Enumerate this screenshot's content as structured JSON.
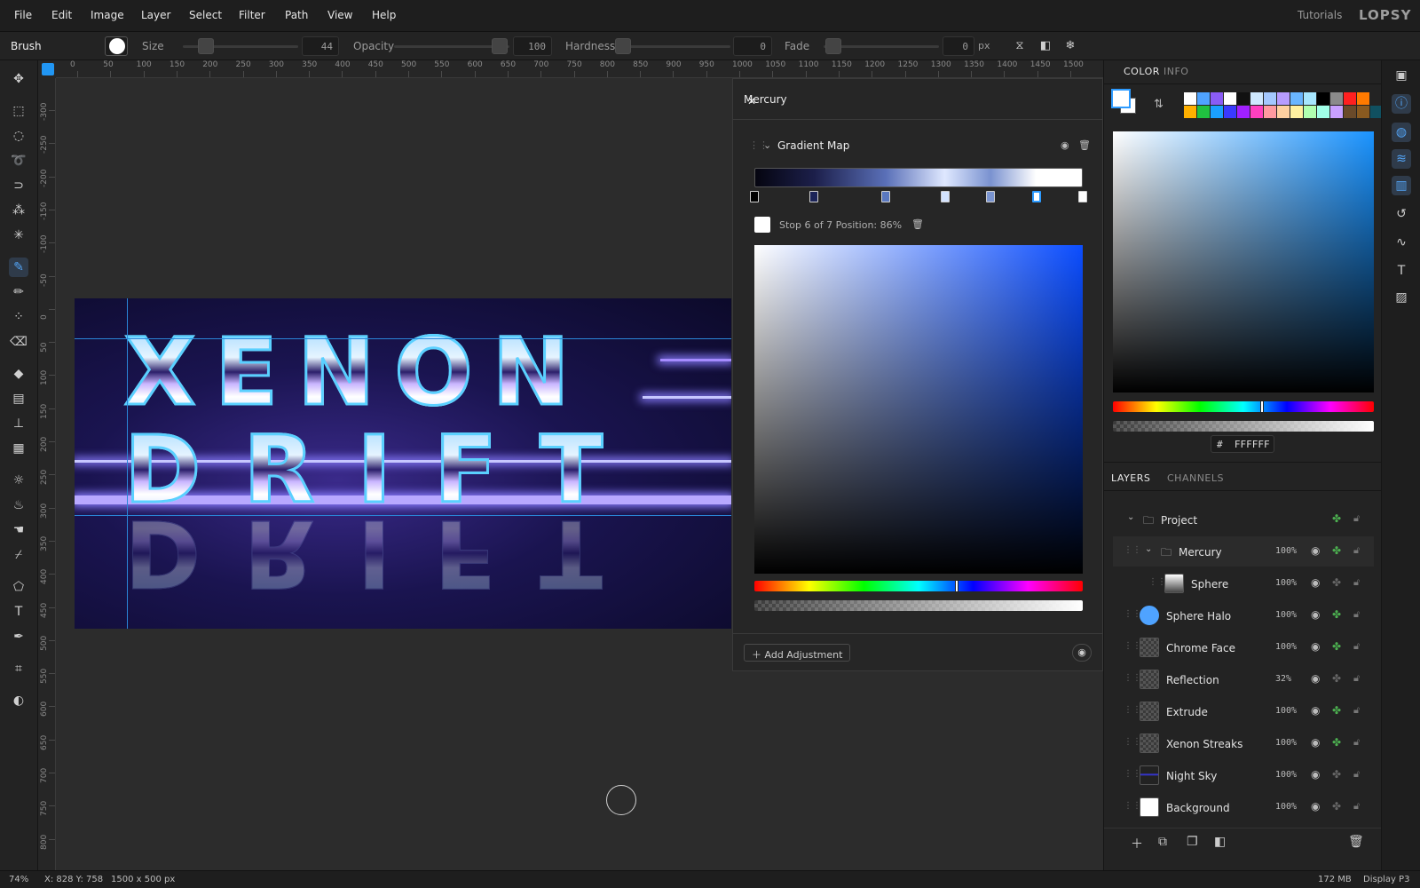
{
  "menu": [
    "File",
    "Edit",
    "Image",
    "Layer",
    "Select",
    "Filter",
    "Path",
    "View",
    "Help"
  ],
  "header": {
    "tutorials": "Tutorials",
    "logo": "LOPSY"
  },
  "options": {
    "tool": "Brush",
    "size_label": "Size",
    "size_value": "44",
    "opacity_label": "Opacity",
    "opacity_value": "100",
    "hardness_label": "Hardness",
    "hardness_value": "0",
    "fade_label": "Fade",
    "fade_value": "0",
    "fade_unit": "px"
  },
  "tools": [
    "move-icon",
    "rect-select-icon",
    "ellipse-select-icon",
    "lasso-icon",
    "magnetic-lasso-icon",
    "magic-wand-icon",
    "quick-select-icon",
    "brush-icon",
    "pencil-icon",
    "spray-icon",
    "eraser-icon",
    "bucket-icon",
    "gradient-icon",
    "stamp-icon",
    "pattern-icon",
    "dodge-icon",
    "burn-icon",
    "smudge-icon",
    "eyedropper-icon",
    "polygon-icon",
    "text-icon",
    "pen-icon",
    "crop-icon",
    "contrast-icon"
  ],
  "ruler": {
    "h": [
      "0",
      "50",
      "100",
      "150",
      "200",
      "250",
      "300",
      "350",
      "400",
      "450",
      "500",
      "550",
      "600",
      "650",
      "700",
      "750",
      "800",
      "850",
      "900",
      "950",
      "1000",
      "1050",
      "1100",
      "1150",
      "1200",
      "1250",
      "1300",
      "1350",
      "1400",
      "1450",
      "1500"
    ],
    "v": [
      "-300",
      "-250",
      "-200",
      "-150",
      "-100",
      "-50",
      "0",
      "50",
      "100",
      "150",
      "200",
      "250",
      "300",
      "350",
      "400",
      "450",
      "500",
      "550",
      "600",
      "650",
      "700",
      "750",
      "800"
    ]
  },
  "artwork": {
    "line1": "XENON",
    "line2": "DRIFT"
  },
  "adjustments": {
    "title": "Mercury",
    "item": "Gradient Map",
    "stop_info": "Stop 6 of 7   Position: 86%",
    "stops": [
      {
        "pos": 0,
        "color": "#000000"
      },
      {
        "pos": 18,
        "color": "#1c2458"
      },
      {
        "pos": 40,
        "color": "#5a78c0"
      },
      {
        "pos": 58,
        "color": "#d4e4ff"
      },
      {
        "pos": 72,
        "color": "#7a94d0"
      },
      {
        "pos": 86,
        "color": "#ffffff",
        "selected": true
      },
      {
        "pos": 100,
        "color": "#ffffff"
      }
    ],
    "add_label": "Add Adjustment"
  },
  "color": {
    "tab_color": "COLOR",
    "tab_info": "INFO",
    "hex_prefix": "#",
    "hex": "FFFFFF",
    "palette": [
      "#ffffff",
      "#4fa3ff",
      "#8a5cf6",
      "#ffffff",
      "#111111",
      "#cfe8ff",
      "#a4c8ff",
      "#b79cff",
      "#69b5ff",
      "#a6e6ff",
      "#000000",
      "#8a8a8a",
      "#ff2020",
      "#ff7a00",
      "#ffb000",
      "#20c040",
      "#1aa0ff",
      "#3a3aff",
      "#a020ff",
      "#ff40c0",
      "#ff9aa0",
      "#ffd0a0",
      "#fff0a0",
      "#b0ffb0",
      "#a0ffe8",
      "#c8a0ff",
      "#6a4a2a",
      "#8a5a20",
      "#105060"
    ]
  },
  "layers": {
    "tab_layers": "LAYERS",
    "tab_channels": "CHANNELS",
    "items": [
      {
        "name": "Project",
        "opacity": "",
        "kind": "group"
      },
      {
        "name": "Mercury",
        "opacity": "100%",
        "kind": "group"
      },
      {
        "name": "Sphere",
        "opacity": "100%",
        "kind": "layer"
      },
      {
        "name": "Sphere Halo",
        "opacity": "100%",
        "kind": "layer"
      },
      {
        "name": "Chrome Face",
        "opacity": "100%",
        "kind": "layer"
      },
      {
        "name": "Reflection",
        "opacity": "32%",
        "kind": "layer"
      },
      {
        "name": "Extrude",
        "opacity": "100%",
        "kind": "layer"
      },
      {
        "name": "Xenon Streaks",
        "opacity": "100%",
        "kind": "layer"
      },
      {
        "name": "Night Sky",
        "opacity": "100%",
        "kind": "layer"
      },
      {
        "name": "Background",
        "opacity": "100%",
        "kind": "layer"
      }
    ]
  },
  "status": {
    "zoom": "74%",
    "coords": "X: 828  Y: 758",
    "size": "1500 x 500 px",
    "memory": "172 MB",
    "profile": "Display P3"
  }
}
